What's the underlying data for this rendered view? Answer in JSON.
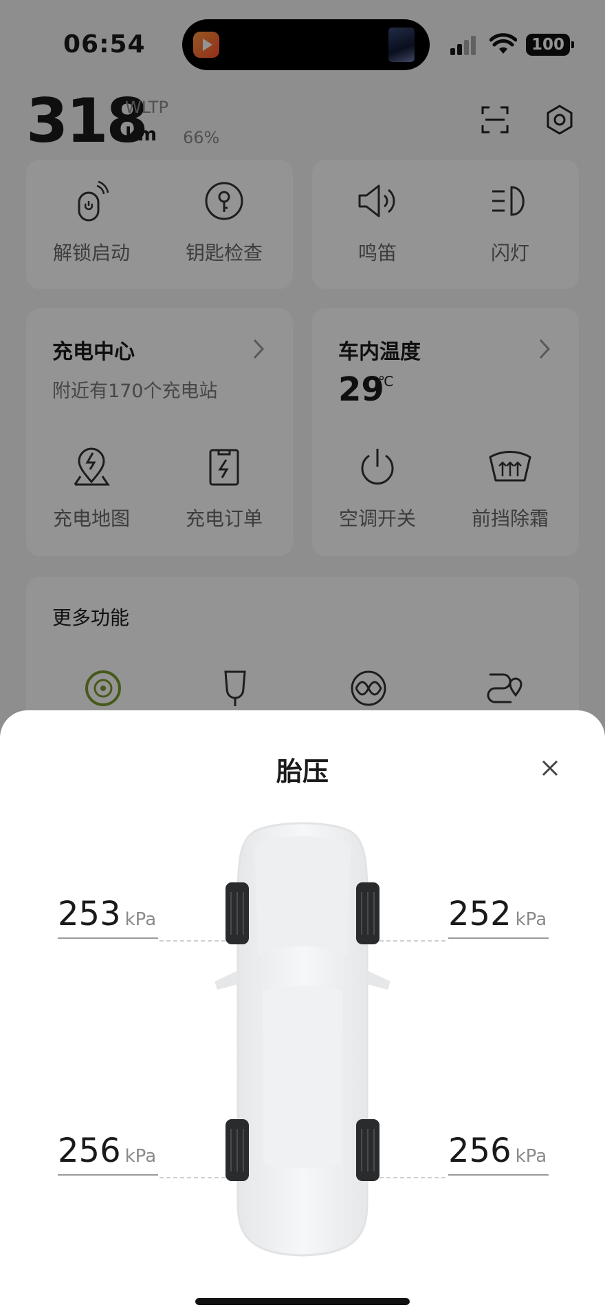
{
  "status_bar": {
    "time": "06:54",
    "battery": "100"
  },
  "header": {
    "range": "318",
    "standard": "WLTP",
    "unit": "km",
    "battery_percent": "66%"
  },
  "quick_actions": [
    {
      "label": "解锁启动",
      "icon": "remote-start-icon"
    },
    {
      "label": "钥匙检查",
      "icon": "key-icon"
    },
    {
      "label": "鸣笛",
      "icon": "horn-icon"
    },
    {
      "label": "闪灯",
      "icon": "headlight-icon"
    }
  ],
  "charging_card": {
    "title": "充电中心",
    "subtitle": "附近有170个充电站",
    "actions": [
      {
        "label": "充电地图",
        "icon": "charge-map-icon"
      },
      {
        "label": "充电订单",
        "icon": "charge-order-icon"
      }
    ]
  },
  "climate_card": {
    "title": "车内温度",
    "temperature": "29",
    "temperature_unit": "℃",
    "actions": [
      {
        "label": "空调开关",
        "icon": "power-icon"
      },
      {
        "label": "前挡除霜",
        "icon": "defrost-icon"
      }
    ]
  },
  "more_card": {
    "title": "更多功能",
    "icons": [
      "tire-icon",
      "seat-icon",
      "battery-cycle-icon",
      "route-icon"
    ]
  },
  "tire_sheet": {
    "title": "胎压",
    "unit": "kPa",
    "front_left": "253",
    "front_right": "252",
    "rear_left": "256",
    "rear_right": "256"
  },
  "colors": {
    "accent_green": "#7a9a2e",
    "overlay": "#000000"
  }
}
